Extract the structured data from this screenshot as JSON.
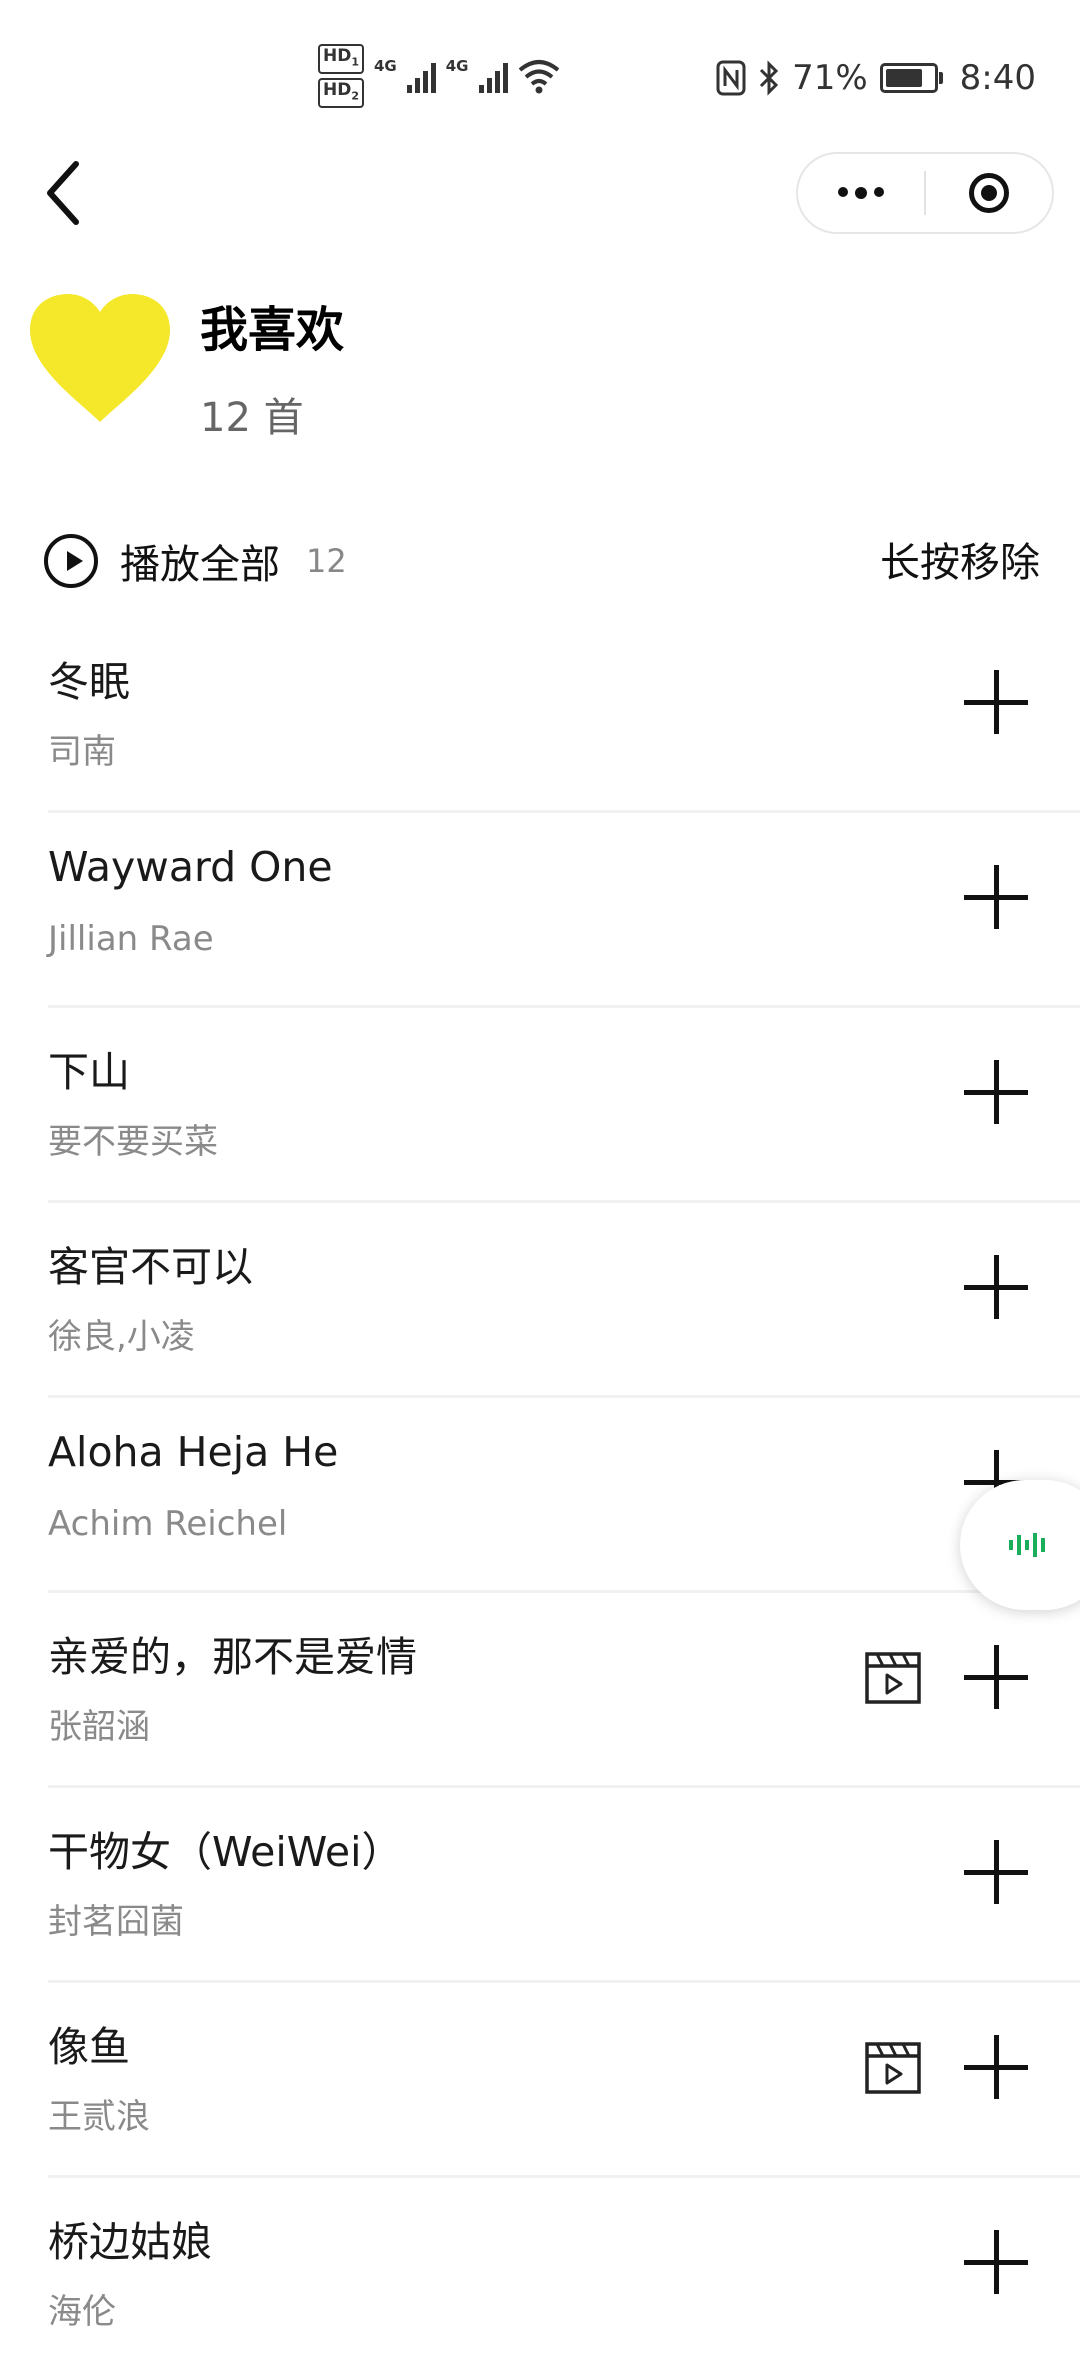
{
  "status_bar": {
    "hd1": "HD",
    "hd1_sub": "1",
    "hd2": "HD",
    "hd2_sub": "2",
    "net1": "4G",
    "net2": "4G",
    "battery_text": "71%",
    "time": "8:40",
    "icons": [
      "nfc-icon",
      "bluetooth-icon",
      "wifi-icon",
      "battery-icon"
    ]
  },
  "nav": {
    "back_icon": "chevron-left-icon",
    "more_icon": "more-dots-icon",
    "close_icon": "target-circle-icon"
  },
  "playlist": {
    "title": "我喜欢",
    "count_label": "12 首",
    "cover_color": "#f5e82a"
  },
  "toolbar": {
    "play_all_label": "播放全部",
    "play_all_count": "12",
    "long_press_remove": "长按移除"
  },
  "songs": [
    {
      "title": "冬眠",
      "artist": "司南",
      "mv": false
    },
    {
      "title": "Wayward One",
      "artist": "Jillian Rae",
      "mv": false
    },
    {
      "title": "下山",
      "artist": "要不要买菜",
      "mv": false
    },
    {
      "title": "客官不可以",
      "artist": "徐良,小凌",
      "mv": false
    },
    {
      "title": "Aloha Heja He",
      "artist": "Achim Reichel",
      "mv": false
    },
    {
      "title": "亲爱的，那不是爱情",
      "artist": "张韶涵",
      "mv": true
    },
    {
      "title": "干物女（WeiWei）",
      "artist": "封茗囧菌",
      "mv": false
    },
    {
      "title": "像鱼",
      "artist": "王贰浪",
      "mv": true
    },
    {
      "title": "桥边姑娘",
      "artist": "海伦",
      "mv": false
    }
  ],
  "floating_player": {
    "icon": "audio-wave-icon",
    "color": "#1aad5a"
  }
}
